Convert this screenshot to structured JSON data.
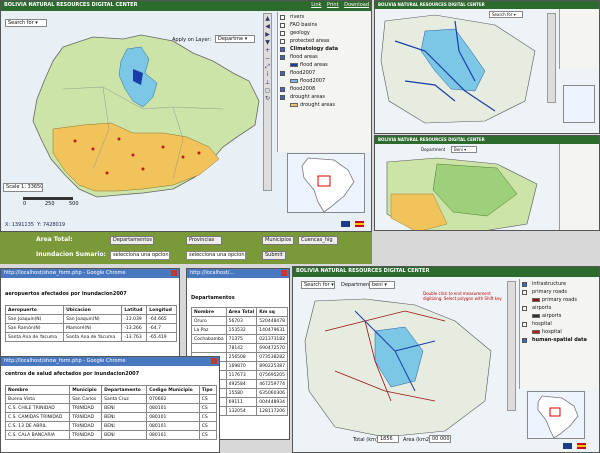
{
  "app": {
    "title": "BOLIVIA NATURAL RESOURCES DIGITAL CENTER",
    "title_main_right": "BOLIVIA NATURAL RESOURCES DIGITAL CENTER",
    "links": [
      "Link",
      "Print",
      "Download"
    ]
  },
  "main_map": {
    "search_placeholder": "Search for",
    "apply_label": "Apply on Layer:",
    "layer_select": "Departme",
    "scale_label": "Scale 1:",
    "scale_value": "3365067",
    "scalebar_ticks": [
      "0",
      "250",
      "500"
    ],
    "coords_x": "1391135",
    "coords_y": "7428019",
    "legend": [
      {
        "label": "rivers",
        "checked": false
      },
      {
        "label": "FAO basins",
        "checked": false
      },
      {
        "label": "geology",
        "checked": false
      },
      {
        "label": "protected areas",
        "checked": false
      },
      {
        "label": "Climatology data",
        "checked": true
      },
      {
        "label": "flood areas",
        "checked": true
      },
      {
        "label": "flood areas",
        "checked": false,
        "swatch": "#1a3ea8"
      },
      {
        "label": "flood2007",
        "checked": true
      },
      {
        "label": "flood2007",
        "checked": false,
        "swatch": "#79b9e6"
      },
      {
        "label": "flood2008",
        "checked": true
      },
      {
        "label": "drought areas",
        "checked": true
      },
      {
        "label": "drought areas",
        "checked": false,
        "swatch": "#e8c56a"
      }
    ]
  },
  "query_bar": {
    "area_total_label": "Area Total:",
    "inundacion_label": "Inundacion Sumario:",
    "buttons": [
      "Departamentos",
      "Provincias",
      "Municipios",
      "Cuencas_hig"
    ],
    "select_1": "selecciona una opcion",
    "select_2": "selecciona una opcion",
    "submit": "Submit"
  },
  "top_right": {
    "title": "BOLIVIA NATURAL RESOURCES DIGITAL CENTER",
    "search_placeholder": "Search for"
  },
  "mid_right": {
    "title": "BOLIVIA NATURAL RESOURCES DIGITAL CENTER",
    "department_label": "Department",
    "department_value": "Beni"
  },
  "popup1": {
    "window_title": "http://localhost/show_form.php - Google Chrome",
    "heading": "aeropuertos afectados por inundacion2007",
    "columns": [
      "Aeropuerto",
      "Ubicacion",
      "Latitud",
      "Longitud"
    ],
    "rows": [
      [
        "San Joaquín(N)",
        "San Joaquín(N)",
        "-13.039",
        "-64.665"
      ],
      [
        "San Ramón(N)",
        "Mamoré(N)",
        "-13.266",
        "-64.7"
      ],
      [
        "Santa Ana de Yacuma",
        "Santa Ana de Yacuma",
        "-13.763",
        "-65.419"
      ]
    ]
  },
  "popup2": {
    "window_title": "http://localhost/...",
    "heading": "Departamentos",
    "columns": [
      "Nombre",
      "Area Total",
      "Km sq"
    ],
    "rows": [
      [
        "Oruro",
        "56703",
        "520448478"
      ],
      [
        "La Paz",
        "153532",
        "140479631"
      ],
      [
        "Cochabamba",
        "71375",
        "021373182"
      ],
      [
        "",
        "78142",
        "690472570"
      ],
      [
        "",
        "256508",
        "073538282"
      ],
      [
        "",
        "169870",
        "890225387"
      ],
      [
        "",
        "117673",
        "075695205"
      ],
      [
        "",
        "492584",
        "467259774"
      ],
      [
        "",
        "15580",
        "635060306"
      ],
      [
        "",
        "69111",
        "004448934"
      ],
      [
        "",
        "132054",
        "128117206"
      ]
    ]
  },
  "popup3": {
    "window_title": "http://localhost/show_form.php - Google Chrome",
    "heading": "centros de salud afectados por inundacion2007",
    "columns": [
      "Nombre",
      "Municipio",
      "Departamento",
      "Codigo Municipio",
      "Tipo"
    ],
    "rows": [
      [
        "Buena Vista",
        "San Carlos",
        "Santa Cruz",
        "070602",
        "CS"
      ],
      [
        "C.S. CHILE TRINIDAD",
        "TRINIDAD",
        "BENI",
        "080101",
        "CS"
      ],
      [
        "C.S. CAMIDAS TRINIDAD",
        "TRINIDAD",
        "BENI",
        "080101",
        "CS"
      ],
      [
        "C.S. 13 DE ABRIL",
        "TRINIDAD",
        "BENI",
        "080101",
        "CS"
      ],
      [
        "C.S. CALA BANCARIA",
        "TRINIDAD",
        "BENI",
        "080101",
        "CS"
      ]
    ]
  },
  "bottom_right": {
    "title": "BOLIVIA NATURAL RESOURCES DIGITAL CENTER",
    "search_placeholder": "Search for",
    "department_label": "Department",
    "department_value": "beni",
    "hint": "Double click to end measurement digitizing. Select polygon with Shift key",
    "total_label": "Total (km):",
    "total_value": "1856",
    "area_label": "Area (km2):",
    "area_value": "00 000",
    "legend": [
      {
        "label": "infrastructure",
        "checked": true
      },
      {
        "label": "primary roads",
        "checked": false
      },
      {
        "label": "primary roads",
        "checked": false
      },
      {
        "label": "airports",
        "checked": false
      },
      {
        "label": "airports",
        "checked": false
      },
      {
        "label": "hospital",
        "checked": false
      },
      {
        "label": "hospital",
        "checked": false
      },
      {
        "label": "human-spatial data",
        "checked": true
      }
    ]
  }
}
